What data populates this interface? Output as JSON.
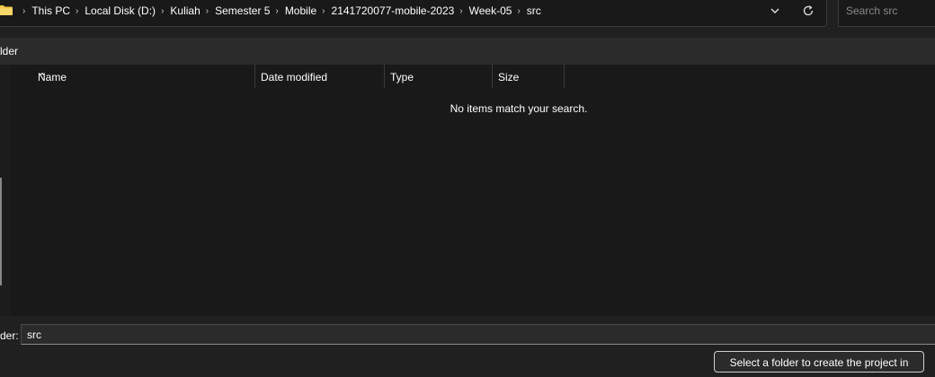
{
  "breadcrumb": {
    "items": [
      "This PC",
      "Local Disk (D:)",
      "Kuliah",
      "Semester 5",
      "Mobile",
      "2141720077-mobile-2023",
      "Week-05",
      "src"
    ]
  },
  "search": {
    "placeholder": "Search src"
  },
  "command_bar": {
    "new_folder_label": "lder"
  },
  "columns": {
    "name": "Name",
    "date_modified": "Date modified",
    "type": "Type",
    "size": "Size"
  },
  "list": {
    "empty_message": "No items match your search."
  },
  "footer": {
    "folder_label": "der:",
    "folder_value": "src",
    "select_button_label": "Select a folder to create the project in"
  },
  "colors": {
    "folder_icon": "#f3c94a",
    "background": "#191919"
  }
}
